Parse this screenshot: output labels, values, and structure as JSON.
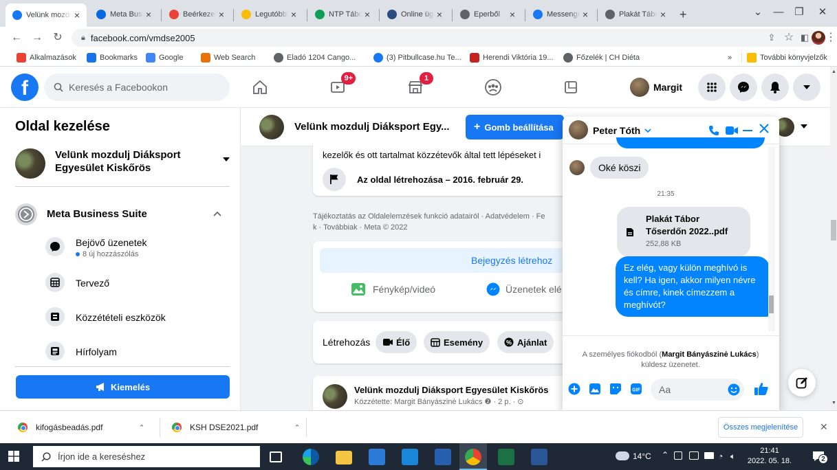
{
  "browser": {
    "tabs": [
      {
        "title": "Velünk mozdulj",
        "icon_color": "#1877f2",
        "icon": "facebook-icon",
        "active": true
      },
      {
        "title": "Meta Business",
        "icon_color": "#0668e1",
        "icon": "meta-icon"
      },
      {
        "title": "Beérkezett",
        "icon_color": "#ea4335",
        "icon": "gmail-icon"
      },
      {
        "title": "Legutóbbi",
        "icon_color": "#fbbc05",
        "icon": "drive-icon"
      },
      {
        "title": "NTP Tábor",
        "icon_color": "#0f9d58",
        "icon": "sheets-icon"
      },
      {
        "title": "Online ügy",
        "icon_color": "#2b4c7e",
        "icon": "online-icon"
      },
      {
        "title": "Eperből",
        "icon_color": "#5f6368",
        "icon": "globe-icon"
      },
      {
        "title": "Messenger",
        "icon_color": "#1877f2",
        "icon": "facebook-icon"
      },
      {
        "title": "Plakát Tábor",
        "icon_color": "#5f6368",
        "icon": "globe-icon"
      }
    ],
    "new_tab": "+",
    "url": "facebook.com/vmdse2005",
    "bookmarks": [
      {
        "label": "Alkalmazások",
        "icon": "apps-icon",
        "color": "#ea4335"
      },
      {
        "label": "Bookmarks",
        "icon": "star-icon",
        "color": "#1a73e8"
      },
      {
        "label": "Google",
        "icon": "google-icon",
        "color": "#4285f4"
      },
      {
        "label": "Web Search",
        "icon": "websearch-icon",
        "color": "#e8710a"
      },
      {
        "label": "Eladó 1204 Cango...",
        "icon": "globe-icon",
        "color": "#5f6368"
      },
      {
        "label": "(3) Pitbullcase.hu Te...",
        "icon": "facebook-icon",
        "color": "#1877f2"
      },
      {
        "label": "Herendi Viktória 19...",
        "icon": "herendi-icon",
        "color": "#c5221f"
      },
      {
        "label": "Főzelék | CH Diéta",
        "icon": "chdieta-icon",
        "color": "#5f6368"
      }
    ],
    "bookmarks_more": "»",
    "other_bookmarks": "További könyvjelzők"
  },
  "fb": {
    "logo": "f",
    "search_placeholder": "Keresés a Facebookon",
    "video_badge": "9+",
    "marketplace_badge": "1",
    "profile_name": "Margit"
  },
  "sidebar": {
    "title": "Oldal kezelése",
    "page_name": "Velünk mozdulj Diáksport Egyesület Kiskőrös",
    "mbs_label": "Meta Business Suite",
    "items": [
      {
        "label": "Bejövő üzenetek",
        "sub": "8 új hozzászólás",
        "icon": "inbox-icon"
      },
      {
        "label": "Tervező",
        "icon": "planner-icon"
      },
      {
        "label": "Közzétételi eszközök",
        "icon": "publishing-tools-icon"
      },
      {
        "label": "Hírfolyam",
        "icon": "news-feed-icon"
      }
    ],
    "promote_label": "Kiemelés"
  },
  "main": {
    "page_title": "Velünk mozdulj Diáksport Egy...",
    "setup_button": "Gomb beállítása",
    "plus": "+",
    "about_text": "kezelők és ott tartalmat közzétevők által tett lépéseket i",
    "created_text": "Az oldal létrehozása – 2016. február 29.",
    "footer_line1": "Tájékoztatás az Oldalelemzések funkció adatairól · Adatvédelem · Fe",
    "footer_line2": "k · Továbbiak · Meta © 2022",
    "create_post": "Bejegyzés létrehoz",
    "photo_video": "Fénykép/videó",
    "messages": "Üzenetek elé",
    "create_label": "Létrehozás",
    "live": "Élő",
    "event": "Esemény",
    "offer": "Ajánlat",
    "post_author": "Velünk mozdulj Diáksport Egyesület Kiskőrös",
    "post_meta": "Közzétette: Margit Bányászinė Lukács ❷ · 2 p. · ⊙"
  },
  "chat": {
    "contact": "Peter Tóth",
    "msg_in": "Oké köszi",
    "time": "21:35",
    "file_name_line1": "Plakát Tábor",
    "file_name_line2": "Tőserdőn 2022..pdf",
    "file_size": "252,88 KB",
    "msg_out": "Ez elég, vagy külön meghívó is kell? Ha igen, akkor milyen névre és címre, kinek címezzem a meghívót?",
    "notice_pre": "A személyes fiókodból (",
    "notice_name": "Margit Bányászinė Lukács",
    "notice_post": ") küldesz üzenetet.",
    "input_placeholder": "Aa"
  },
  "downloads": {
    "files": [
      "kifogásbeadás.pdf",
      "KSH DSE2021.pdf"
    ],
    "show_all": "Összes megjelenítése"
  },
  "taskbar": {
    "search_placeholder": "Írjon ide a kereséshez",
    "temp": "14°C",
    "time": "21:41",
    "date": "2022. 05. 18.",
    "notif_count": "2"
  },
  "colors": {
    "fb_blue": "#1877f2",
    "messenger_blue": "#0084ff",
    "badge_red": "#e41e3f"
  }
}
